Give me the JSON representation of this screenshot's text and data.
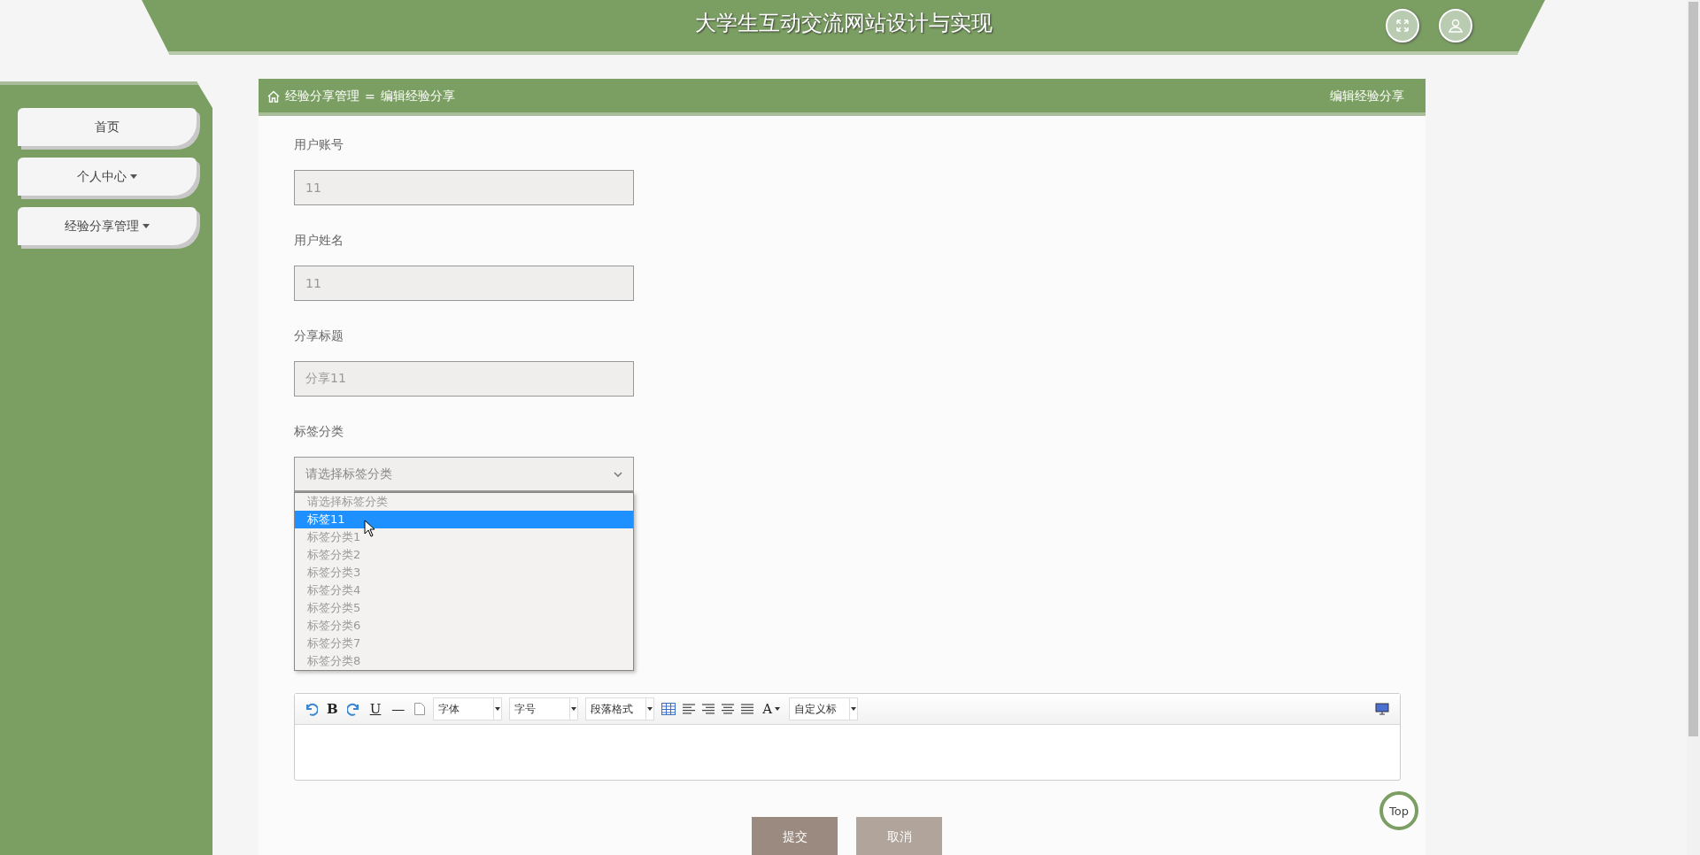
{
  "header": {
    "title": "大学生互动交流网站设计与实现"
  },
  "sidebar": {
    "items": [
      {
        "label": "首页",
        "has_menu": false
      },
      {
        "label": "个人中心",
        "has_menu": true
      },
      {
        "label": "经验分享管理",
        "has_menu": true
      }
    ]
  },
  "breadcrumb": {
    "items": [
      "经验分享管理",
      "编辑经验分享"
    ],
    "separator": "=",
    "page_title": "编辑经验分享"
  },
  "form": {
    "fields": [
      {
        "label": "用户账号",
        "kind": "input",
        "value": "11",
        "disabled": true
      },
      {
        "label": "用户姓名",
        "kind": "input",
        "value": "11",
        "disabled": true
      },
      {
        "label": "分享标题",
        "kind": "input",
        "value": "分享11",
        "disabled": true
      },
      {
        "label": "标签分类",
        "kind": "select",
        "placeholder": "请选择标签分类",
        "expanded": true,
        "options": [
          {
            "label": "请选择标签分类",
            "selected": false
          },
          {
            "label": "标签11",
            "selected": true
          },
          {
            "label": "标签分类1",
            "selected": false
          },
          {
            "label": "标签分类2",
            "selected": false
          },
          {
            "label": "标签分类3",
            "selected": false
          },
          {
            "label": "标签分类4",
            "selected": false
          },
          {
            "label": "标签分类5",
            "selected": false
          },
          {
            "label": "标签分类6",
            "selected": false
          },
          {
            "label": "标签分类7",
            "selected": false
          },
          {
            "label": "标签分类8",
            "selected": false
          }
        ]
      }
    ]
  },
  "editor": {
    "toolbar": [
      {
        "kind": "undo"
      },
      {
        "kind": "bold",
        "text": "B"
      },
      {
        "kind": "redo"
      },
      {
        "kind": "underline",
        "text": "U"
      },
      {
        "kind": "rule",
        "text": "—"
      },
      {
        "kind": "page"
      },
      {
        "kind": "menu",
        "text": "字体"
      },
      {
        "kind": "menu",
        "text": "字号"
      },
      {
        "kind": "menu",
        "text": "段落格式"
      },
      {
        "kind": "table"
      },
      {
        "kind": "align-left"
      },
      {
        "kind": "align-right"
      },
      {
        "kind": "align-center"
      },
      {
        "kind": "align-justify"
      },
      {
        "kind": "color",
        "text": "A"
      },
      {
        "kind": "menu",
        "text": "自定义标"
      },
      {
        "kind": "preview"
      }
    ]
  },
  "buttons": [
    {
      "label": "提交",
      "kind": "primary"
    },
    {
      "label": "取消",
      "kind": "secondary"
    }
  ],
  "back_to_top": "Top"
}
